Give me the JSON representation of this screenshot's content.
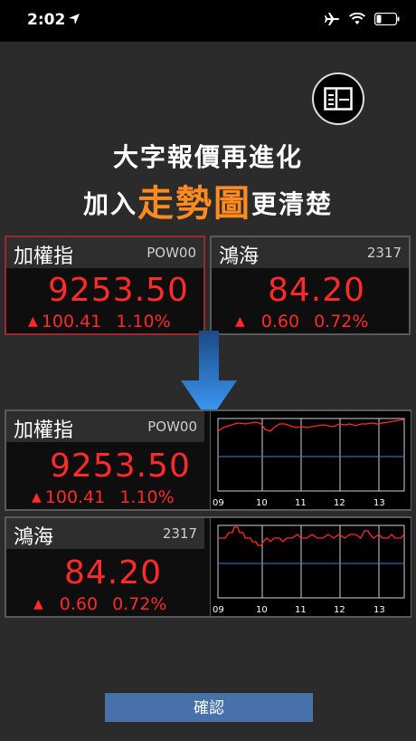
{
  "status": {
    "time": "2:02"
  },
  "headline": {
    "line1": "大字報價再進化",
    "line2_prefix": "加入",
    "line2_accent": "走勢圖",
    "line2_suffix": "更清楚"
  },
  "cards_top": [
    {
      "name": "加權指",
      "code": "POW00",
      "price": "9253.50",
      "change": "100.41",
      "percent": "1.10%"
    },
    {
      "name": "鴻海",
      "code": "2317",
      "price": "84.20",
      "change": "0.60",
      "percent": "0.72%"
    }
  ],
  "cards_bottom": [
    {
      "name": "加權指",
      "code": "POW00",
      "price": "9253.50",
      "change": "100.41",
      "percent": "1.10%"
    },
    {
      "name": "鴻海",
      "code": "2317",
      "price": "84.20",
      "change": "0.60",
      "percent": "0.72%"
    }
  ],
  "chart_ticks": [
    "09",
    "10",
    "11",
    "12",
    "13"
  ],
  "colors": {
    "up": "#ff2a2a",
    "accent": "#ff8a1f",
    "button": "#4771a8"
  },
  "confirm_label": "確認"
}
